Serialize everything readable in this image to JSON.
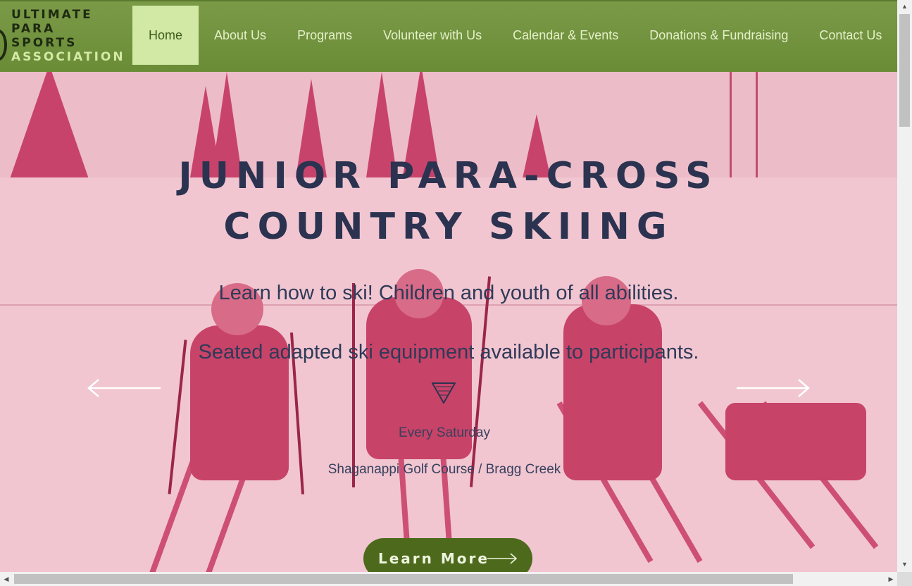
{
  "logo": {
    "lines": [
      "ULTIMATE",
      "PARA",
      "SPORTS",
      "ASSOCIATION"
    ]
  },
  "nav": {
    "items": [
      {
        "label": "Home",
        "active": true
      },
      {
        "label": "About Us",
        "active": false
      },
      {
        "label": "Programs",
        "active": false
      },
      {
        "label": "Volunteer with Us",
        "active": false
      },
      {
        "label": "Calendar & Events",
        "active": false
      },
      {
        "label": "Donations & Fundraising",
        "active": false
      },
      {
        "label": "Contact Us",
        "active": false
      }
    ]
  },
  "hero": {
    "title_line1": "JUNIOR PARA-CROSS",
    "title_line2": "COUNTRY SKIING",
    "subtitle1": "Learn how to ski! Children and youth of all abilities.",
    "subtitle2": "Seated adapted ski equipment available to participants.",
    "schedule": "Every Saturday",
    "location": "Shaganappi Golf Course / Bragg Creek",
    "cta_label": "Learn More"
  },
  "colors": {
    "header_green": "#6a8c36",
    "nav_active_bg": "#d1e9a5",
    "hero_tint": "#e25c80",
    "title_navy": "#2b3350",
    "button_green": "#4d6a1c"
  },
  "icons": {
    "prev_slide": "arrow-left-icon",
    "next_slide": "arrow-right-icon",
    "cta_arrow": "arrow-right-icon",
    "triangle": "triangle-down-icon"
  }
}
